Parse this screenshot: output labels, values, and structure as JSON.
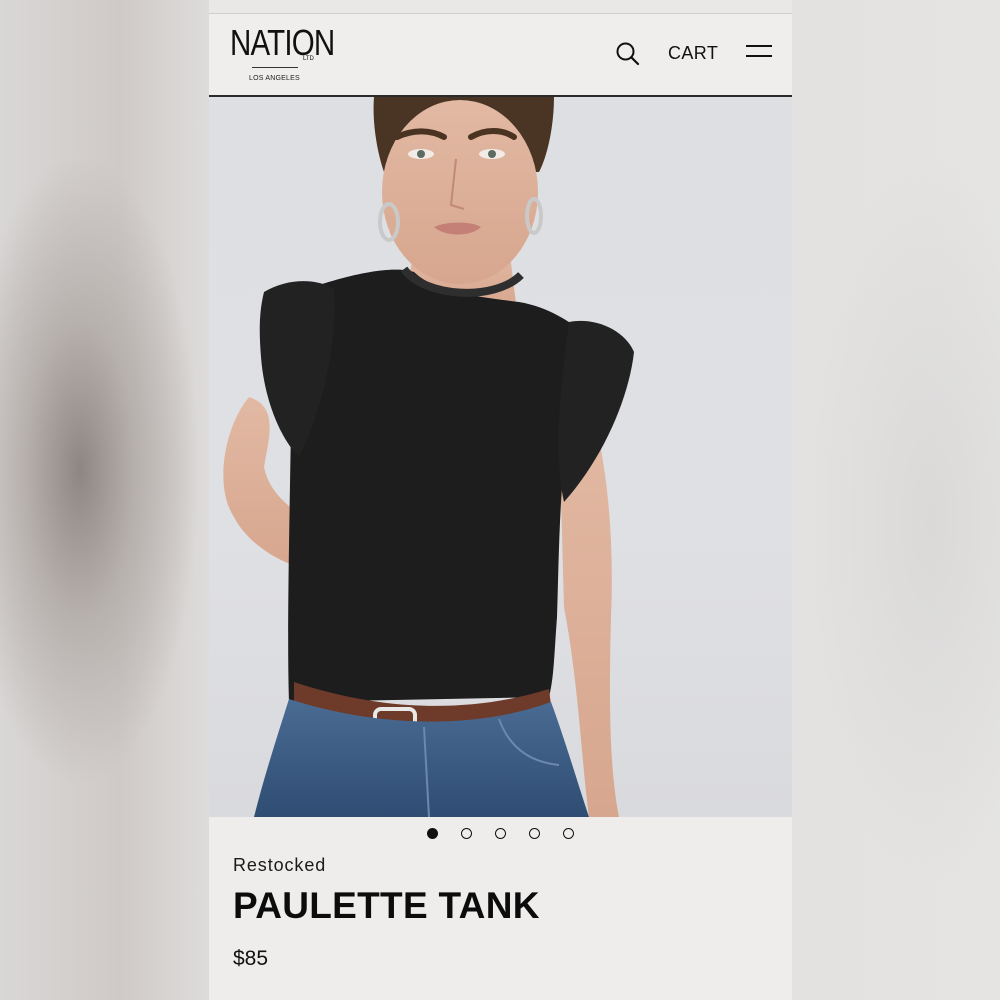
{
  "header": {
    "logo_word": "NATION",
    "logo_ltd": "LTD",
    "logo_city": "LOS ANGELES",
    "search_icon": "search-icon",
    "cart_label": "CART",
    "menu_icon": "hamburger-menu-icon"
  },
  "product": {
    "image_alt": "Model wearing black ruffle-sleeve tank with denim and brown belt",
    "carousel": {
      "total": 5,
      "active_index": 0
    },
    "tag": "Restocked",
    "title": "PAULETTE TANK",
    "price": "$85"
  },
  "colors": {
    "page_bg": "#eeedeb",
    "text": "#111111",
    "image_bg": "#dedfe3",
    "top": "#1c1c1c",
    "denim": "#3f5f86"
  }
}
